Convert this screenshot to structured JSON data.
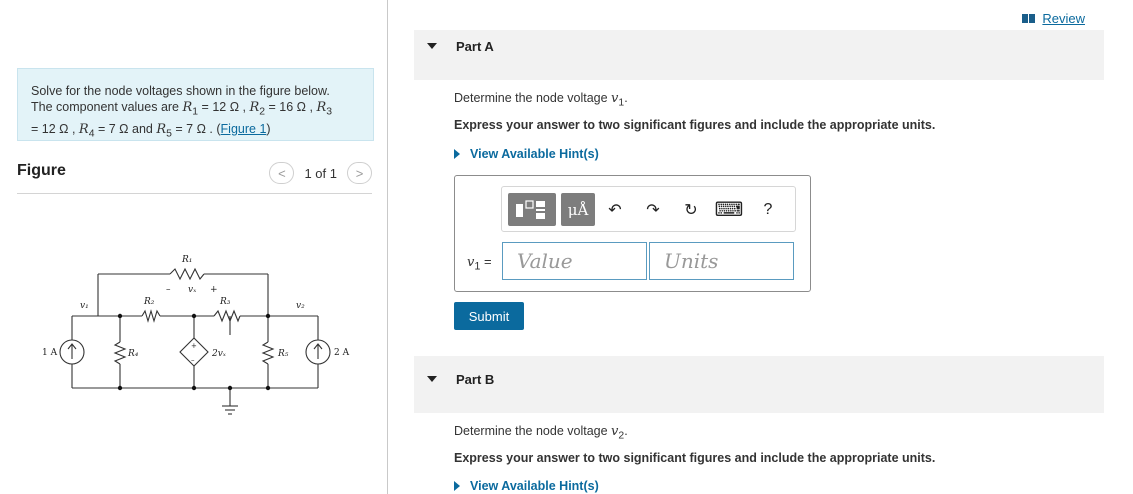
{
  "problem": {
    "line1": "Solve for the node voltages shown in the figure below.",
    "line2_prefix": "The component values are ",
    "r1": "R",
    "r1_sub": "1",
    "r1_val": " = 12 Ω , ",
    "r2": "R",
    "r2_sub": "2",
    "r2_val": " = 16 Ω , ",
    "r3": "R",
    "r3_sub": "3",
    "line3_start": "= 12 Ω , ",
    "r4": "R",
    "r4_sub": "4",
    "r4_val": " = 7 Ω and ",
    "r5": "R",
    "r5_sub": "5",
    "r5_val": " = 7 Ω . (",
    "figure_link": "Figure 1",
    "close_paren": ")"
  },
  "figure": {
    "title": "Figure",
    "pager": "1 of 1",
    "prev": "<",
    "next": ">"
  },
  "circuit": {
    "r1": "R₁",
    "r2": "R₂",
    "r3": "R₃",
    "r4": "R₄",
    "r5": "R₅",
    "vx": "vₓ",
    "minus": "–",
    "plus": "+",
    "v1": "v₁",
    "v2": "v₂",
    "src1": "1 A",
    "src2": "2 A",
    "dep": "2vₓ",
    "dep_plus": "+",
    "dep_minus": "–"
  },
  "header": {
    "review": "Review"
  },
  "partA": {
    "label": "Part A",
    "question_prefix": "Determine the node voltage ",
    "question_var": "v",
    "question_sub": "1",
    "question_suffix": ".",
    "instruction": "Express your answer to two significant figures and include the appropriate units.",
    "hint": "View Available Hint(s)",
    "var_label": "v",
    "var_sub": "1",
    "var_eq": " =",
    "value_placeholder": "Value",
    "units_placeholder": "Units",
    "mu_label": "μÅ",
    "undo": "↶",
    "redo": "↷",
    "reset": "↻",
    "keyboard": "⌨",
    "help": "?",
    "submit": "Submit"
  },
  "partB": {
    "label": "Part B",
    "question_prefix": "Determine the node voltage ",
    "question_var": "v",
    "question_sub": "2",
    "question_suffix": ".",
    "instruction": "Express your answer to two significant figures and include the appropriate units.",
    "hint": "View Available Hint(s)"
  }
}
